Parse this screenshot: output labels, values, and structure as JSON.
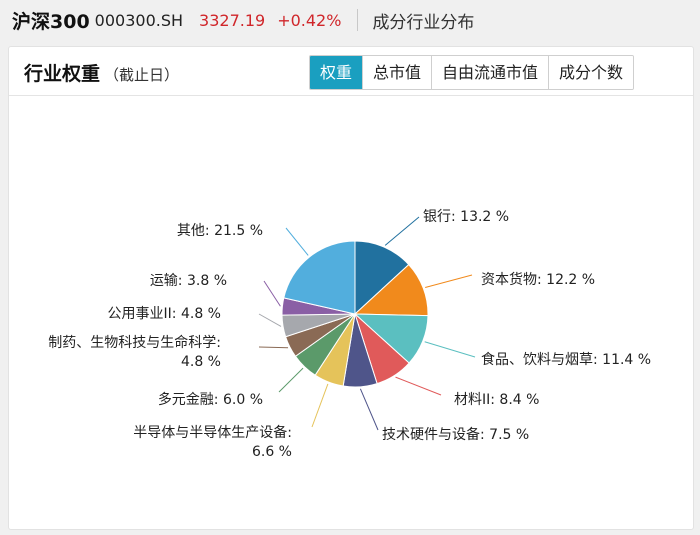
{
  "header": {
    "index_name": "沪深300",
    "index_code": "000300.SH",
    "price": "3327.19",
    "change_pct": "+0.42%",
    "page_label": "成分行业分布"
  },
  "card": {
    "title": "行业权重",
    "subtitle": "（截止日）",
    "tabs": [
      {
        "label": "权重",
        "active": true
      },
      {
        "label": "总市值",
        "active": false
      },
      {
        "label": "自由流通市值",
        "active": false
      },
      {
        "label": "成分个数",
        "active": false
      }
    ]
  },
  "colors": {
    "accent": "#1a9fc0",
    "price_up": "#d0262a"
  },
  "chart_data": {
    "type": "pie",
    "unit": "%",
    "slices": [
      {
        "name": "银行",
        "value": 13.2,
        "label": "银行: 13.2 %",
        "color": "#21719f"
      },
      {
        "name": "资本货物",
        "value": 12.2,
        "label": "资本货物: 12.2 %",
        "color": "#f18a1c"
      },
      {
        "name": "食品、饮料与烟草",
        "value": 11.4,
        "label": "食品、饮料与烟草: 11.4 %",
        "color": "#5bbfc0"
      },
      {
        "name": "材料II",
        "value": 8.4,
        "label": "材料II: 8.4 %",
        "color": "#e05a5a"
      },
      {
        "name": "技术硬件与设备",
        "value": 7.5,
        "label": "技术硬件与设备: 7.5 %",
        "color": "#4f558a"
      },
      {
        "name": "半导体与半导体生产设备",
        "value": 6.6,
        "label": [
          "半导体与半导体生产设备:",
          "6.6 %"
        ],
        "color": "#e5c35a"
      },
      {
        "name": "多元金融",
        "value": 6.0,
        "label": "多元金融: 6.0 %",
        "color": "#5b9a6a"
      },
      {
        "name": "制药、生物科技与生命科学",
        "value": 4.8,
        "label": [
          "制药、生物科技与生命科学:",
          "4.8 %"
        ],
        "color": "#8a6a55"
      },
      {
        "name": "公用事业II",
        "value": 4.8,
        "label": "公用事业II: 4.8 %",
        "color": "#a6a8ad"
      },
      {
        "name": "运输",
        "value": 3.8,
        "label": "运输: 3.8 %",
        "color": "#8a5fa5"
      },
      {
        "name": "其他",
        "value": 21.5,
        "label": "其他: 21.5 %",
        "color": "#52aedd"
      }
    ]
  }
}
